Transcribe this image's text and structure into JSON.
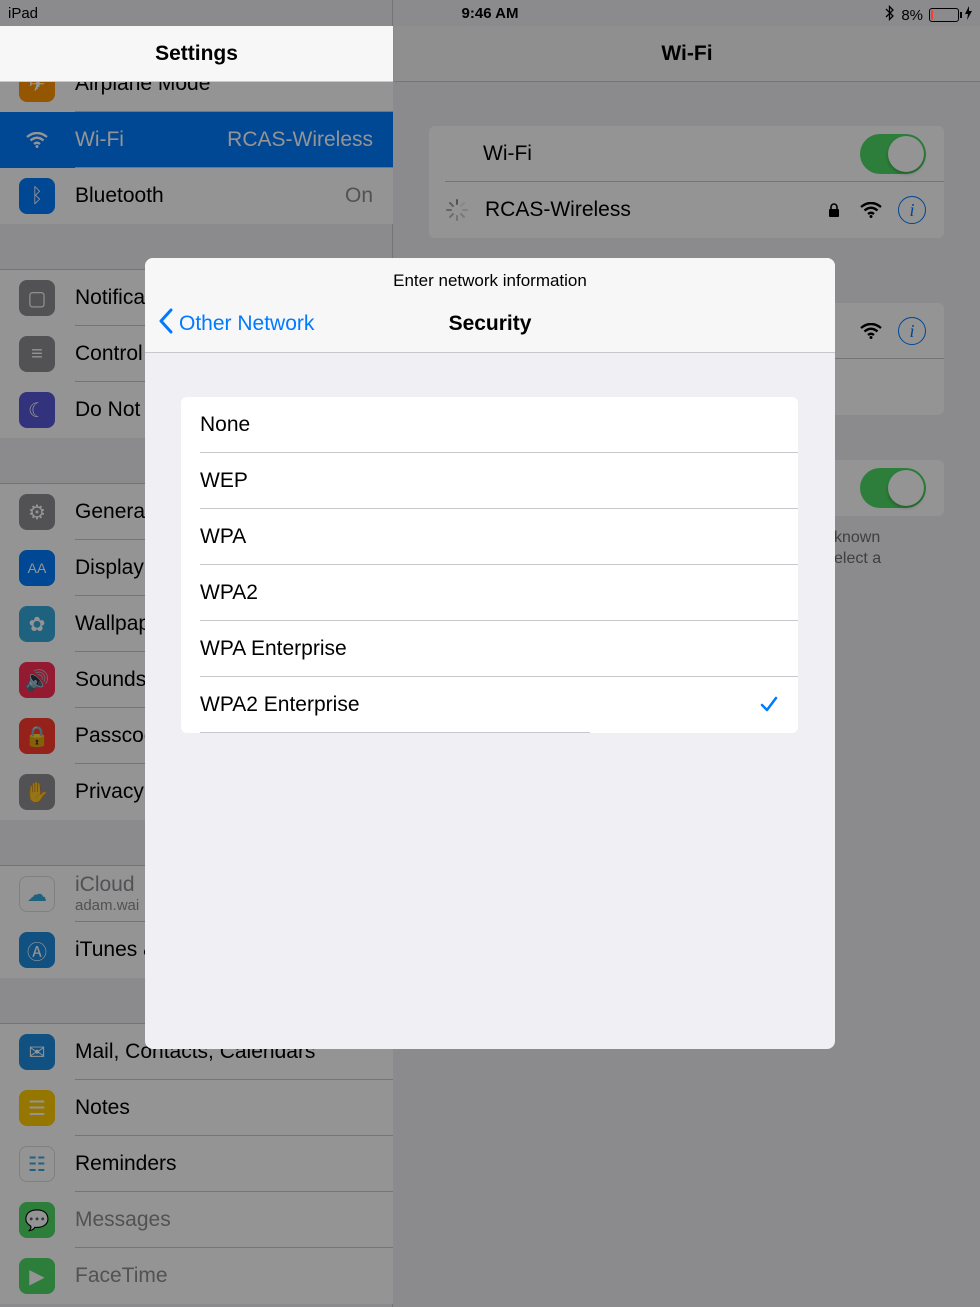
{
  "status_bar": {
    "device": "iPad",
    "time": "9:46 AM",
    "battery_percent": "8%",
    "battery_level": 0.08
  },
  "master": {
    "title": "Settings",
    "groups": [
      [
        {
          "name": "airplane",
          "label": "Airplane Mode",
          "value": "",
          "icon": "airplane-icon",
          "color": "#ff9500"
        },
        {
          "name": "wifi",
          "label": "Wi-Fi",
          "value": "RCAS-Wireless",
          "icon": "wifi-icon",
          "color": "#007aff",
          "selected": true
        },
        {
          "name": "bluetooth",
          "label": "Bluetooth",
          "value": "On",
          "icon": "bluetooth-icon",
          "color": "#007aff"
        }
      ],
      [
        {
          "name": "notification-center",
          "label": "Notification Center",
          "icon": "notification-icon",
          "color": "#8e8e93"
        },
        {
          "name": "control-center",
          "label": "Control Center",
          "icon": "control-icon",
          "color": "#8e8e93"
        },
        {
          "name": "do-not-disturb",
          "label": "Do Not Disturb",
          "icon": "moon-icon",
          "color": "#5856d6"
        }
      ],
      [
        {
          "name": "general",
          "label": "General",
          "icon": "gear-icon",
          "color": "#8e8e93"
        },
        {
          "name": "display",
          "label": "Display",
          "icon": "text-size-icon",
          "color": "#007aff"
        },
        {
          "name": "wallpaper",
          "label": "Wallpaper",
          "icon": "flower-icon",
          "color": "#34aadc"
        },
        {
          "name": "sounds",
          "label": "Sounds",
          "icon": "speaker-icon",
          "color": "#ff2d55"
        },
        {
          "name": "passcode",
          "label": "Passcode",
          "icon": "lock-icon",
          "color": "#ff3b30"
        },
        {
          "name": "privacy",
          "label": "Privacy",
          "icon": "hand-icon",
          "color": "#8e8e93"
        }
      ],
      [
        {
          "name": "icloud",
          "label": "iCloud",
          "sub": "adam.wai",
          "icon": "cloud-icon",
          "color": "#ffffff",
          "dim": true
        },
        {
          "name": "itunes",
          "label": "iTunes & App Store",
          "icon": "app-store-icon",
          "color": "#1d8ce0"
        }
      ],
      [
        {
          "name": "mail",
          "label": "Mail, Contacts, Calendars",
          "icon": "mail-icon",
          "color": "#1d8ce0"
        },
        {
          "name": "notes",
          "label": "Notes",
          "icon": "notes-icon",
          "color": "#ffcc00"
        },
        {
          "name": "reminders",
          "label": "Reminders",
          "icon": "list-icon",
          "color": "#ffffff"
        },
        {
          "name": "messages",
          "label": "Messages",
          "icon": "message-icon",
          "color": "#4cd964",
          "dim": true
        },
        {
          "name": "facetime",
          "label": "FaceTime",
          "icon": "camera-icon",
          "color": "#4cd964",
          "dim": true
        }
      ]
    ]
  },
  "detail": {
    "title": "Wi-Fi",
    "wifi_label": "Wi-Fi",
    "network_name": "RCAS-Wireless",
    "note_line1": "known",
    "note_line2": "elect a"
  },
  "modal": {
    "prompt": "Enter network information",
    "back_label": "Other Network",
    "title": "Security",
    "options": [
      {
        "label": "None",
        "selected": false
      },
      {
        "label": "WEP",
        "selected": false
      },
      {
        "label": "WPA",
        "selected": false
      },
      {
        "label": "WPA2",
        "selected": false
      },
      {
        "label": "WPA Enterprise",
        "selected": false
      },
      {
        "label": "WPA2 Enterprise",
        "selected": true
      }
    ],
    "accent": "#007aff"
  }
}
